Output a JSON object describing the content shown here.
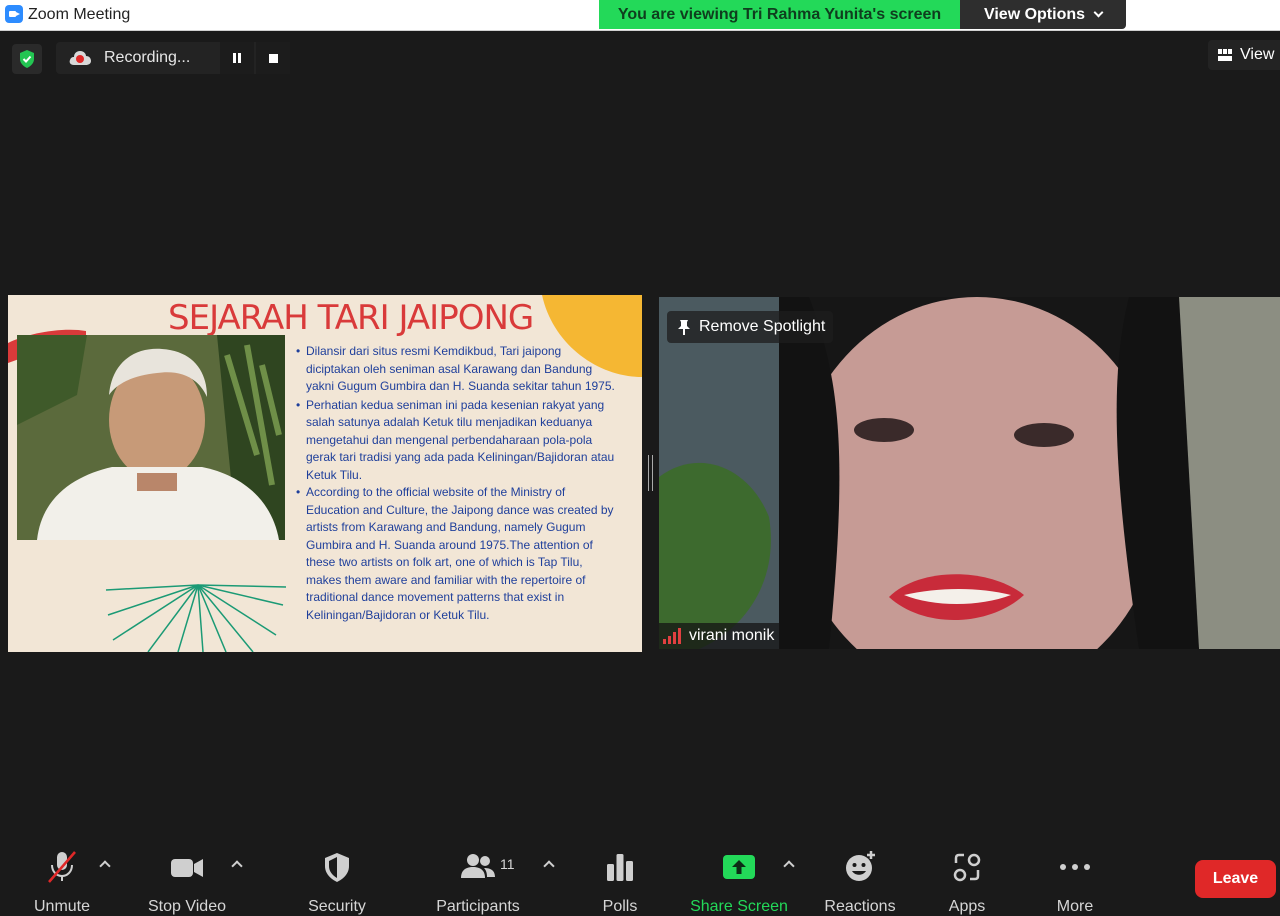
{
  "window": {
    "title": "Zoom Meeting"
  },
  "banner": {
    "viewing_text": "You are viewing Tri Rahma Yunita's screen",
    "view_options_label": "View Options"
  },
  "recording": {
    "label": "Recording..."
  },
  "top_right": {
    "view_label": "View"
  },
  "slide": {
    "title": "SEJARAH TARI JAIPONG",
    "bullets": [
      "Dilansir dari situs resmi Kemdikbud, Tari jaipong diciptakan oleh seniman asal Karawang dan Bandung yakni Gugum Gumbira dan H. Suanda sekitar tahun 1975.",
      "Perhatian kedua seniman ini pada kesenian rakyat yang salah satunya adalah Ketuk tilu menjadikan keduanya mengetahui dan mengenal perbendaharaan pola-pola gerak tari tradisi yang ada pada Keliningan/Bajidoran atau Ketuk Tilu.",
      "According to the official website of the Ministry of Education and Culture, the Jaipong dance was created by artists from Karawang and Bandung, namely Gugum Gumbira and H. Suanda around 1975.The attention of these two artists on folk art, one of which is Tap Tilu, makes them aware and familiar with the repertoire of traditional dance movement patterns that exist in Keliningan/Bajidoran or Ketuk Tilu."
    ]
  },
  "video": {
    "spotlight_label": "Remove Spotlight",
    "participant_name": "virani monik"
  },
  "toolbar": {
    "unmute": "Unmute",
    "stop_video": "Stop Video",
    "security": "Security",
    "participants": "Participants",
    "participants_count": "11",
    "polls": "Polls",
    "share_screen": "Share Screen",
    "reactions": "Reactions",
    "apps": "Apps",
    "more": "More",
    "leave": "Leave"
  },
  "colors": {
    "share_green": "#23d959",
    "leave_red": "#e02828",
    "slide_title_red": "#d93a3a",
    "slide_text_blue": "#1f3f9b"
  }
}
